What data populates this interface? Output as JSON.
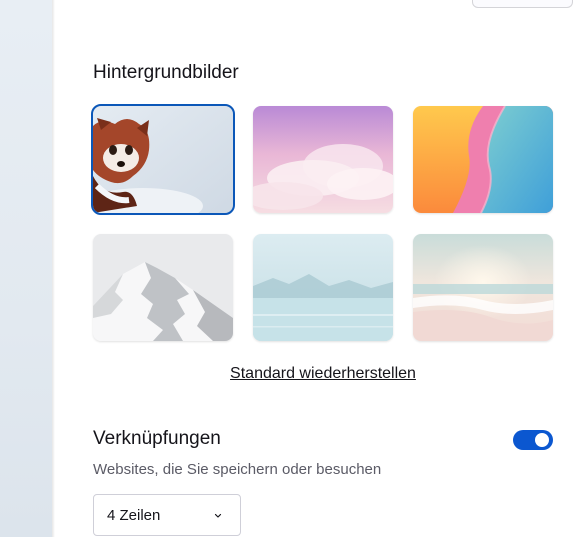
{
  "wallpapers": {
    "title": "Hintergrundbilder",
    "items": [
      {
        "name": "red-panda",
        "selected": true
      },
      {
        "name": "pink-clouds",
        "selected": false
      },
      {
        "name": "abstract-waves",
        "selected": false
      },
      {
        "name": "snowy-mountain",
        "selected": false
      },
      {
        "name": "misty-lake",
        "selected": false
      },
      {
        "name": "beach-sunset",
        "selected": false
      }
    ],
    "restore_label": "Standard wiederherstellen"
  },
  "shortcuts": {
    "title": "Verknüpfungen",
    "description": "Websites, die Sie speichern oder besuchen",
    "enabled": true,
    "rows_select": {
      "value": "4 Zeilen",
      "icon": "chevron-down-icon"
    }
  },
  "colors": {
    "accent": "#0b57d0",
    "selected_outline": "#0b57b8",
    "text": "#15141a",
    "muted_text": "#5b5b66"
  }
}
